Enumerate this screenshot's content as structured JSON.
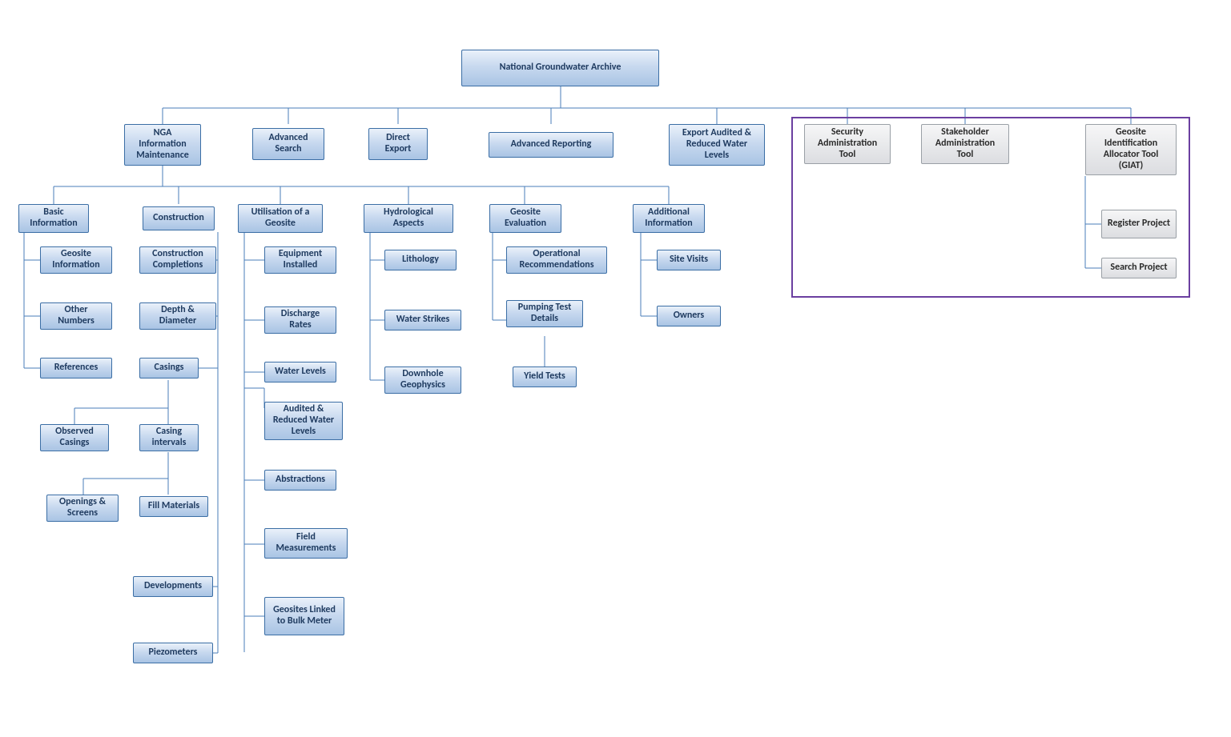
{
  "root": {
    "label": "National Groundwater Archive"
  },
  "tier1": {
    "nga_info": "NGA Information Maintenance",
    "adv_search": "Advanced Search",
    "direct_export": "Direct Export",
    "adv_reporting": "Advanced Reporting",
    "export_audited": "Export Audited & Reduced Water Levels",
    "security_tool": "Security Administration Tool",
    "stakeholder_tool": "Stakeholder Administration Tool",
    "giat": "Geosite Identification Allocator Tool (GIAT)"
  },
  "giat": {
    "register": "Register Project",
    "search": "Search Project"
  },
  "categories": {
    "basic_info": "Basic Information",
    "construction": "Construction",
    "utilisation": "Utilisation of a Geosite",
    "hydro": "Hydrological Aspects",
    "geosite_eval": "Geosite Evaluation",
    "additional": "Additional Information"
  },
  "basic": {
    "geosite_info": "Geosite Information",
    "other_numbers": "Other Numbers",
    "references": "References"
  },
  "construction": {
    "completions": "Construction Completions",
    "depth_diameter": "Depth & Diameter",
    "casings": "Casings",
    "observed_casings": "Observed Casings",
    "casing_intervals": "Casing intervals",
    "openings_screens": "Openings & Screens",
    "fill_materials": "Fill Materials",
    "developments": "Developments",
    "piezometers": "Piezometers"
  },
  "utilisation": {
    "equipment": "Equipment Installed",
    "discharge": "Discharge Rates",
    "water_levels": "Water Levels",
    "audited_wl": "Audited & Reduced Water Levels",
    "abstractions": "Abstractions",
    "field_meas": "Field Measurements",
    "bulk_meter": "Geosites Linked to Bulk Meter"
  },
  "hydro": {
    "lithology": "Lithology",
    "water_strikes": "Water Strikes",
    "downhole": "Downhole Geophysics"
  },
  "geosite": {
    "operational": "Operational Recommendations",
    "pumping_test": "Pumping Test Details",
    "yield_tests": "Yield Tests"
  },
  "additional": {
    "site_visits": "Site Visits",
    "owners": "Owners"
  }
}
